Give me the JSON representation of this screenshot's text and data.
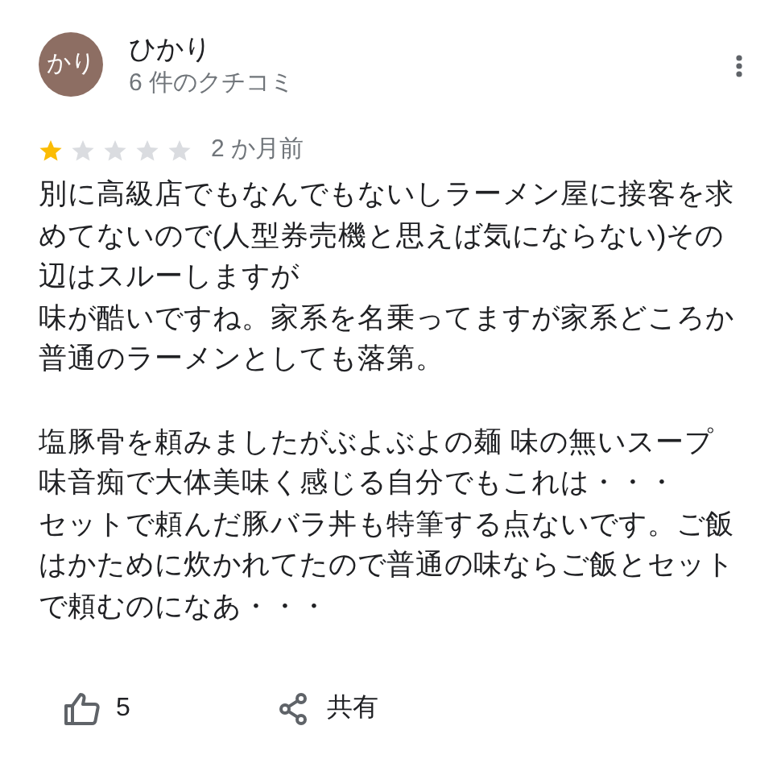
{
  "reviewer": {
    "initials": "かり",
    "name": "ひかり",
    "review_count": "6 件のクチコミ"
  },
  "review": {
    "stars": 1,
    "time": "2 か月前",
    "sections": [
      [
        "別に高級店でもなんでもないしラーメン屋に接客を求めてないので(人型券売機と思えば気にならない)その辺はスルーしますが",
        "味が酷いですね。家系を名乗ってますが家系どころか普通のラーメンとしても落第。"
      ],
      [
        "塩豚骨を頼みましたがぶよぶよの麺 味の無いスープ",
        "味音痴で大体美味く感じる自分でもこれは・・・",
        "セットで頼んだ豚バラ丼も特筆する点ないです。ご飯はかために炊かれてたので普通の味ならご飯とセットで頼むのになあ・・・"
      ]
    ]
  },
  "actions": {
    "like_count": "5",
    "share_label": "共有"
  }
}
